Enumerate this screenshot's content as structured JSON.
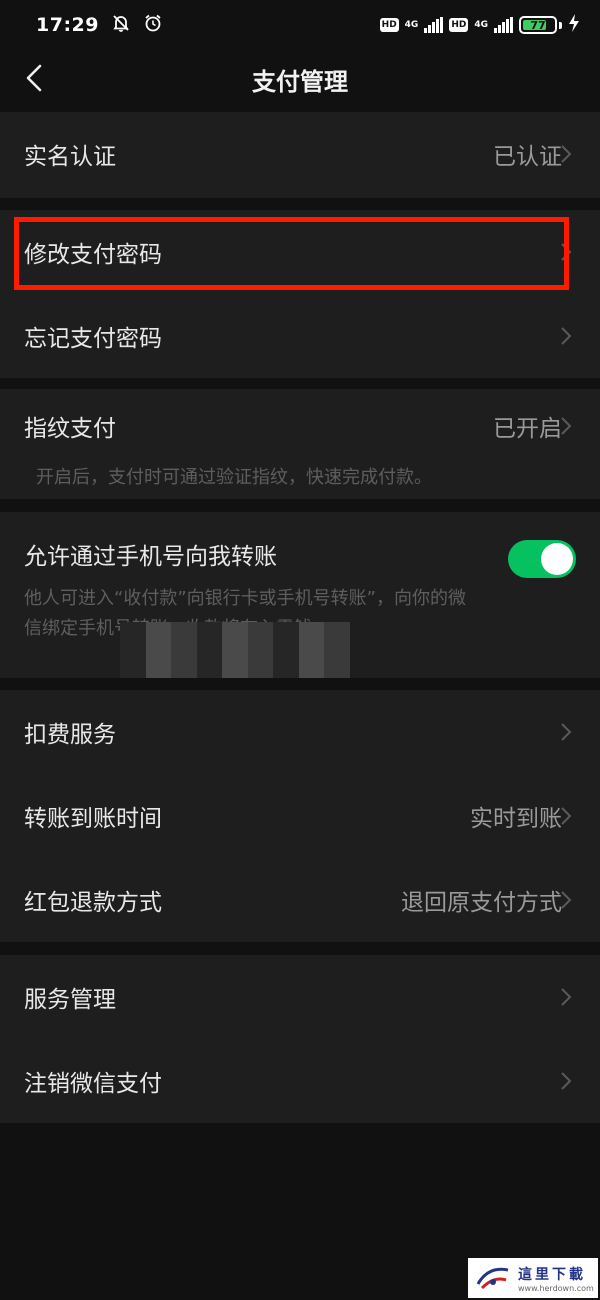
{
  "status_bar": {
    "time": "17:29",
    "hd_label": "HD",
    "network_1": "4G",
    "network_2": "4G",
    "battery_level": "77",
    "battery_fraction": 0.77,
    "accent_green": "#3fca63"
  },
  "nav": {
    "title": "支付管理",
    "back_icon": "chevron-left-icon"
  },
  "groups": [
    {
      "rows": [
        {
          "label": "实名认证",
          "value": "已认证"
        }
      ]
    },
    {
      "rows": [
        {
          "label": "修改支付密码",
          "value": ""
        },
        {
          "label": "忘记支付密码",
          "value": ""
        }
      ]
    },
    {
      "rows": [
        {
          "label": "指纹支付",
          "value": "已开启",
          "description": "开启后，支付时可通过验证指纹，快速完成付款。"
        }
      ]
    },
    {
      "rows": [
        {
          "label": "允许通过手机号向我转账",
          "toggle_on": true,
          "toggle_color": "#07c160",
          "description_line1": "他人可进入“收付款”向银行卡或手机号转账”，向你的微",
          "description_line2": "信绑定手机号转账，收款将存入零钱。"
        }
      ]
    },
    {
      "rows": [
        {
          "label": "扣费服务",
          "value": ""
        },
        {
          "label": "转账到账时间",
          "value": "实时到账"
        },
        {
          "label": "红包退款方式",
          "value": "退回原支付方式"
        }
      ]
    },
    {
      "rows": [
        {
          "label": "服务管理",
          "value": ""
        },
        {
          "label": "注销微信支付",
          "value": ""
        }
      ]
    }
  ],
  "annotation": {
    "highlight_color": "#ff1a00"
  },
  "watermark": {
    "text": "這里下載",
    "url": "www.herdown.com"
  }
}
